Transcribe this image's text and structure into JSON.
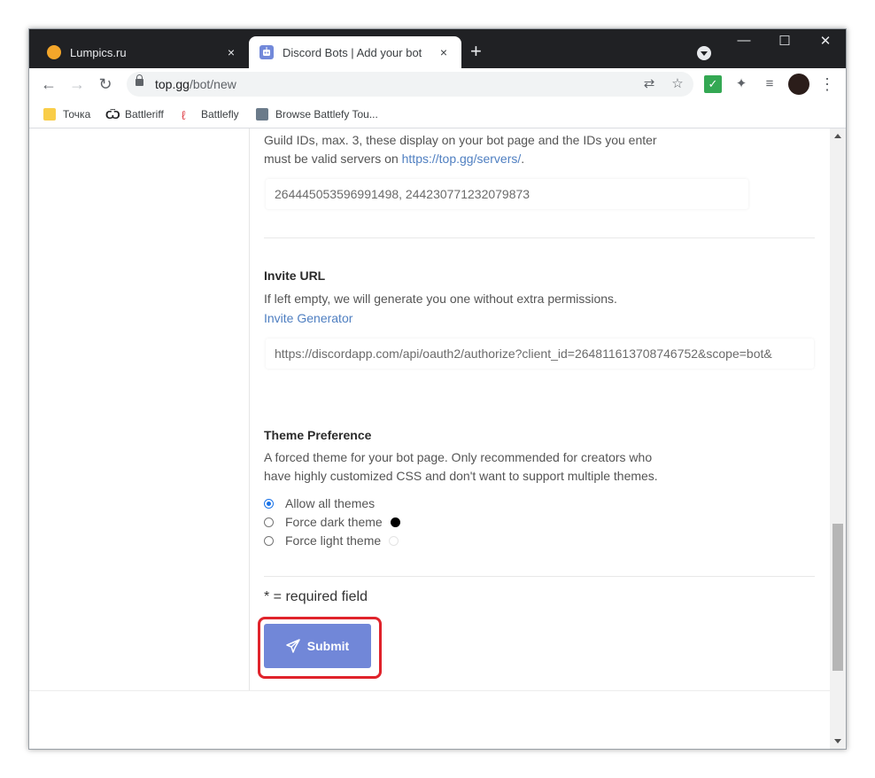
{
  "tabs": [
    {
      "title": "Lumpics.ru",
      "close": "×",
      "active": false
    },
    {
      "title": "Discord Bots | Add your bot",
      "close": "×",
      "active": true
    }
  ],
  "newtab": "+",
  "window_controls": {
    "minimize": "—",
    "maximize": "☐",
    "close": "✕"
  },
  "toolbar": {
    "back": "←",
    "forward": "→",
    "reload": "↻",
    "url_domain": "top.gg",
    "url_path": "/bot/new",
    "translate_icon": "⇄",
    "star_icon": "☆",
    "ext_check": "✓",
    "ext_puzzle": "✦",
    "ext_media": "≡",
    "menu": "⋮"
  },
  "bookmarks": [
    {
      "label": "Точка"
    },
    {
      "label": "Battleriff",
      "icon_text": "Ѿ"
    },
    {
      "label": "Battlefly",
      "icon_text": "ℓ"
    },
    {
      "label": "Browse Battlefy Tou..."
    }
  ],
  "form": {
    "guild_desc_1": "Guild IDs, max. 3, these display on your bot page and the IDs you enter",
    "guild_desc_2a": "must be valid servers on ",
    "guild_link": "https://top.gg/servers/",
    "guild_desc_2b": ".",
    "guild_value": "264445053596991498, 244230771232079873",
    "invite_heading": "Invite URL",
    "invite_desc": "If left empty, we will generate you one without extra permissions.",
    "invite_generator": "Invite Generator",
    "invite_value": "https://discordapp.com/api/oauth2/authorize?client_id=264811613708746752&scope=bot&",
    "theme_heading": "Theme Preference",
    "theme_desc_1": "A forced theme for your bot page. Only recommended for creators who",
    "theme_desc_2": "have highly customized CSS and don't want to support multiple themes.",
    "theme_options": [
      {
        "label": "Allow all themes",
        "checked": true
      },
      {
        "label": "Force dark theme",
        "checked": false,
        "swatch": "#000000"
      },
      {
        "label": "Force light theme",
        "checked": false,
        "swatch": "#ffffff"
      }
    ],
    "required_note": "* = required field",
    "submit_label": "Submit"
  },
  "colors": {
    "accent": "#7187d8",
    "highlight": "#e0232b",
    "link": "#4f7fc1"
  }
}
